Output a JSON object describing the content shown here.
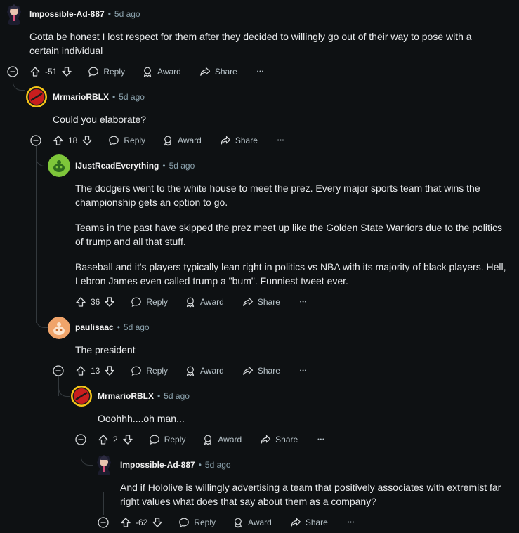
{
  "comments": [
    {
      "user": "Impossible-Ad-887",
      "time": "5d ago",
      "paragraphs": [
        "Gotta be honest I lost respect for them after they decided to willingly go out of their way to pose with a certain individual"
      ],
      "score": "-51"
    },
    {
      "user": "MrmarioRBLX",
      "time": "5d ago",
      "paragraphs": [
        "Could you elaborate?"
      ],
      "score": "18"
    },
    {
      "user": "IJustReadEverything",
      "time": "5d ago",
      "paragraphs": [
        "The dodgers went to the white house to meet the prez. Every major sports team that wins the championship gets an option to go.",
        "Teams in the past have skipped the prez meet up like the Golden State Warriors due to the politics of trump and all that stuff.",
        "Baseball and it's players typically lean right in politics vs NBA with its majority of black players. Hell, Lebron James even called trump a \"bum\". Funniest tweet ever."
      ],
      "score": "36"
    },
    {
      "user": "paulisaac",
      "time": "5d ago",
      "paragraphs": [
        "The president"
      ],
      "score": "13"
    },
    {
      "user": "MrmarioRBLX",
      "time": "5d ago",
      "paragraphs": [
        "Ooohhh....oh man..."
      ],
      "score": "2"
    },
    {
      "user": "Impossible-Ad-887",
      "time": "5d ago",
      "paragraphs": [
        "And if Hololive is willingly advertising a team that positively associates with extremist far right values what does that say about them as a company?"
      ],
      "score": "-62"
    }
  ],
  "labels": {
    "dot": "•",
    "reply": "Reply",
    "award": "Award",
    "share": "Share",
    "more": "•••"
  },
  "icons": [
    "collapse-icon",
    "upvote-icon",
    "downvote-icon",
    "reply-icon",
    "award-icon",
    "share-icon",
    "more-icon"
  ],
  "colors": {
    "background": "#0e1113",
    "thread_line": "#33393d",
    "meta": "#8ba2ad"
  }
}
